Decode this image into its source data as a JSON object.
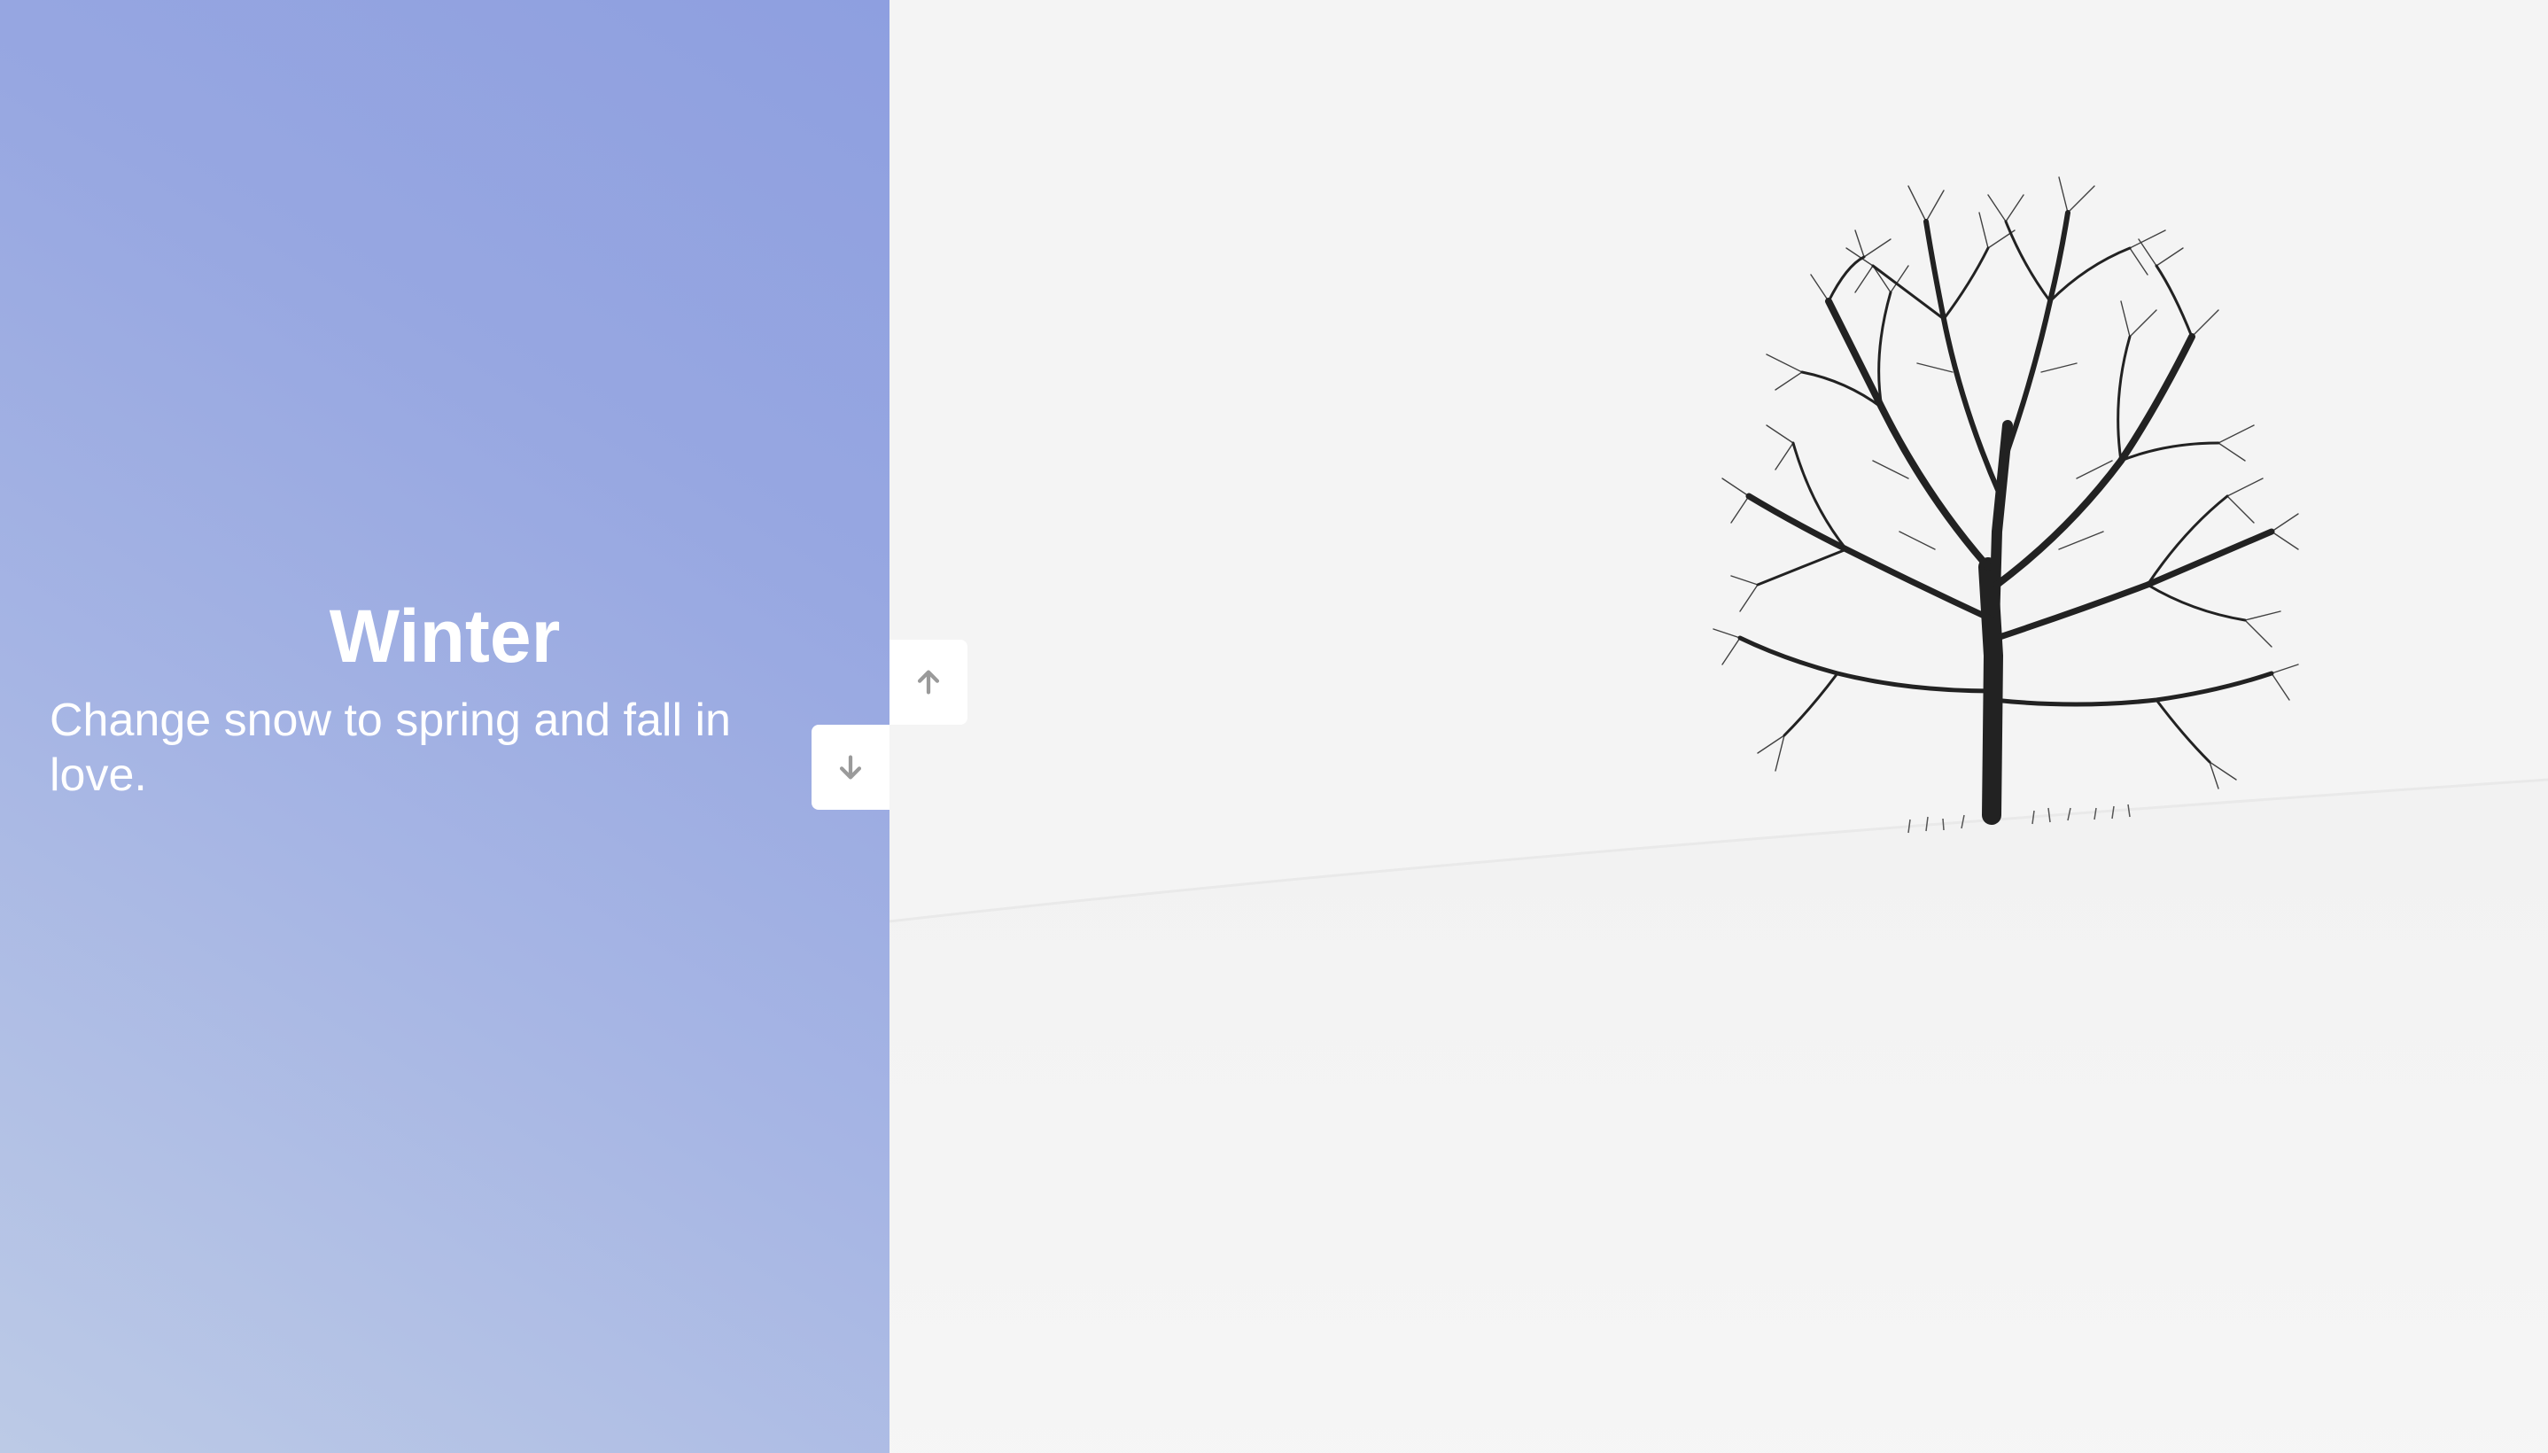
{
  "slide": {
    "title": "Winter",
    "description": "Change snow to spring and fall in love."
  },
  "controls": {
    "up_icon": "arrow-up-icon",
    "down_icon": "arrow-down-icon"
  },
  "colors": {
    "gradient_light": "#bccae6",
    "gradient_dark": "#8e9fe0",
    "text": "#ffffff",
    "button_bg": "#ffffff",
    "button_icon": "#9a9a9a"
  }
}
